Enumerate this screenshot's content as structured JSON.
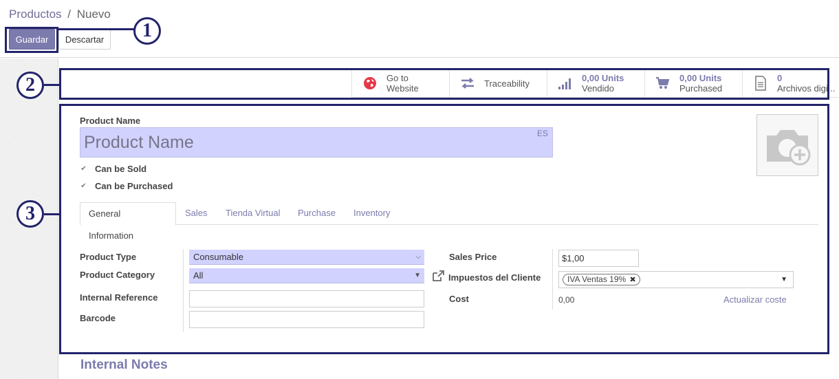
{
  "breadcrumb": {
    "parent": "Productos",
    "separator": "/",
    "current": "Nuevo"
  },
  "toolbar": {
    "save_label": "Guardar",
    "discard_label": "Descartar"
  },
  "annotations": {
    "one": "1",
    "two": "2",
    "three": "3"
  },
  "stat_buttons": {
    "website": {
      "line1": "Go to",
      "line2": "Website",
      "icon": "globe-icon"
    },
    "traceability": {
      "label": "Traceability",
      "icon": "exchange-arrows-icon"
    },
    "sold": {
      "value": "0,00 Units",
      "label": "Vendido",
      "icon": "signal-bars-icon"
    },
    "purchased": {
      "value": "0,00 Units",
      "label": "Purchased",
      "icon": "cart-icon"
    },
    "files": {
      "value": "0",
      "label": "Archivos digi...",
      "icon": "file-icon"
    }
  },
  "form": {
    "product_name_label": "Product Name",
    "product_name_placeholder": "Product Name",
    "lang": "ES",
    "can_be_sold": "Can be Sold",
    "can_be_purchased": "Can be Purchased"
  },
  "tabs": [
    {
      "label": "General Information",
      "active": true
    },
    {
      "label": "Sales"
    },
    {
      "label": "Tienda Virtual"
    },
    {
      "label": "Purchase"
    },
    {
      "label": "Inventory"
    }
  ],
  "general": {
    "product_type_label": "Product Type",
    "product_type_value": "Consumable",
    "product_category_label": "Product Category",
    "product_category_value": "All",
    "internal_reference_label": "Internal Reference",
    "barcode_label": "Barcode",
    "sales_price_label": "Sales Price",
    "sales_price_value": "$1,00",
    "customer_taxes_label": "Impuestos del Cliente",
    "customer_tax_tag": "IVA Ventas 19%",
    "cost_label": "Cost",
    "cost_value": "0,00",
    "update_cost_link": "Actualizar coste"
  },
  "internal_notes_title": "Internal Notes",
  "colors": {
    "brand": "#7c7bad",
    "annotation": "#23236b",
    "required_field": "#d2d2ff"
  }
}
